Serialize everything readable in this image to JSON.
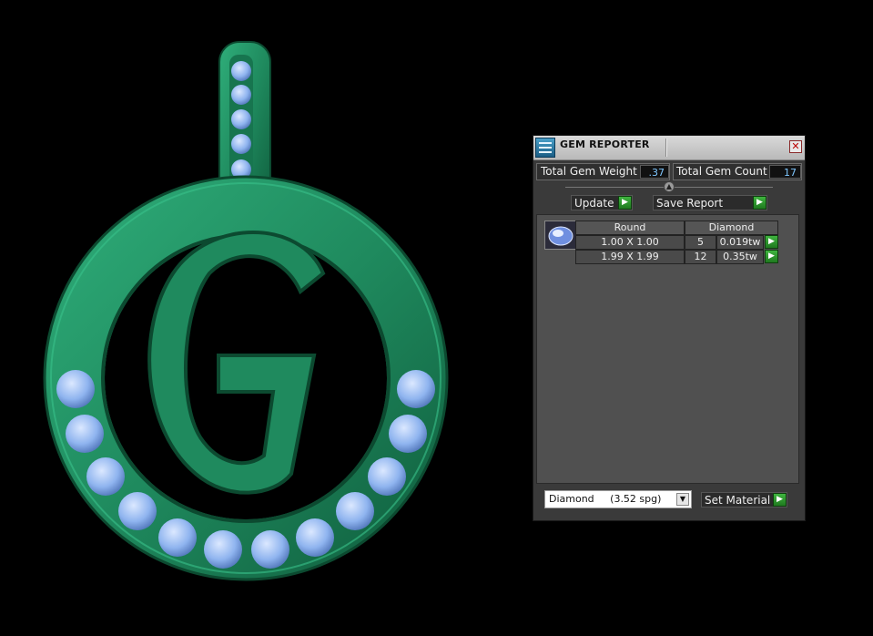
{
  "panel": {
    "title": "GEM REPORTER",
    "close_symbol": "✕",
    "total_gem_weight_label": "Total Gem Weight",
    "total_gem_weight_value": ".37",
    "total_gem_count_label": "Total Gem Count",
    "total_gem_count_value": "17",
    "update_label": "Update",
    "save_report_label": "Save Report",
    "set_material_label": "Set Material",
    "material_value": "Diamond     (3.52 spg)",
    "table": {
      "cut": "Round",
      "material": "Diamond",
      "rows": [
        {
          "size": "1.00 X 1.00",
          "count": "5",
          "weight": "0.019tw"
        },
        {
          "size": "1.99 X 1.99",
          "count": "12",
          "weight": "0.35tw"
        }
      ]
    }
  },
  "icons": {
    "app": "gem-reporter-icon",
    "gem": "round-gem-icon",
    "go": "green-play-icon"
  },
  "colors": {
    "metal": "#1f8a5e",
    "gem": "#8fb4ef",
    "panel_bg": "#3a3a3a",
    "value_text": "#7fc7ff",
    "go_button": "#3fb43f"
  }
}
